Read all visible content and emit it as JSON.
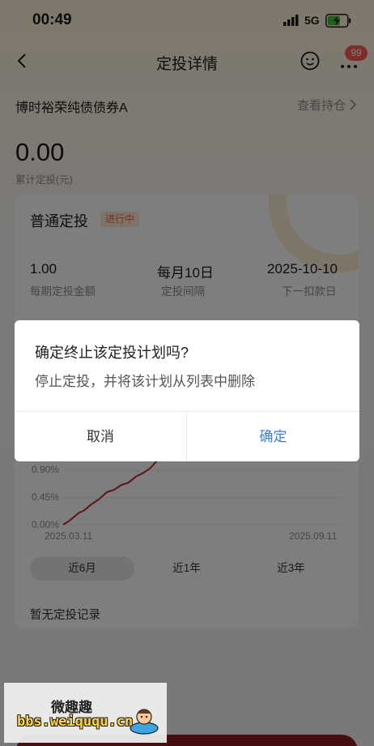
{
  "status_bar": {
    "time": "00:49",
    "network": "5G"
  },
  "nav": {
    "title": "定投详情",
    "badge_count": "99"
  },
  "fund": {
    "name": "博时裕荣纯债债券A",
    "view_holding": "查看持仓"
  },
  "summary": {
    "total_amount": "0.00",
    "total_label": "累计定投(元)"
  },
  "plan": {
    "type": "普通定投",
    "status": "进行中",
    "amount_value": "1.00",
    "amount_label": "每期定投金额",
    "interval_value": "每月10日",
    "interval_label": "定投间隔",
    "next_date_value": "2025-10-10",
    "next_date_label": "下一扣款日"
  },
  "chart_data": {
    "type": "line",
    "y_ticks": [
      "0.90%",
      "0.45%",
      "0.00%"
    ],
    "x_start": "2025.03.11",
    "x_end": "2025.09.11",
    "ylim": [
      0,
      1.35
    ],
    "series": [
      {
        "values": [
          [
            "2025-03-11",
            0.0
          ],
          [
            "2025-03-15",
            0.06
          ],
          [
            "2025-03-18",
            0.12
          ],
          [
            "2025-03-22",
            0.2
          ],
          [
            "2025-03-25",
            0.23
          ],
          [
            "2025-03-30",
            0.33
          ],
          [
            "2025-04-05",
            0.43
          ],
          [
            "2025-04-10",
            0.54
          ],
          [
            "2025-04-15",
            0.58
          ],
          [
            "2025-04-20",
            0.66
          ],
          [
            "2025-04-25",
            0.7
          ],
          [
            "2025-04-30",
            0.8
          ],
          [
            "2025-05-05",
            0.86
          ],
          [
            "2025-05-10",
            0.94
          ],
          [
            "2025-05-13",
            1.02
          ],
          [
            "2025-05-15",
            1.08
          ],
          [
            "2025-05-18",
            1.18
          ],
          [
            "2025-05-20",
            1.22
          ],
          [
            "2025-05-25",
            1.2
          ],
          [
            "2025-05-30",
            1.21
          ],
          [
            "2025-06-05",
            1.23
          ],
          [
            "2025-06-12",
            1.2
          ]
        ],
        "color": "#c0262d"
      }
    ]
  },
  "range_tabs": [
    {
      "label": "近6月",
      "active": true
    },
    {
      "label": "近1年",
      "active": false
    },
    {
      "label": "近3年",
      "active": false
    }
  ],
  "records": {
    "empty_text": "暂无定投记录"
  },
  "dialog": {
    "title": "确定终止该定投计划吗?",
    "message": "停止定投，并将该计划从列表中删除",
    "cancel_label": "取消",
    "confirm_label": "确定"
  },
  "watermark": {
    "line1": "微趣趣",
    "line2": "bbs.weiququ.cn"
  }
}
